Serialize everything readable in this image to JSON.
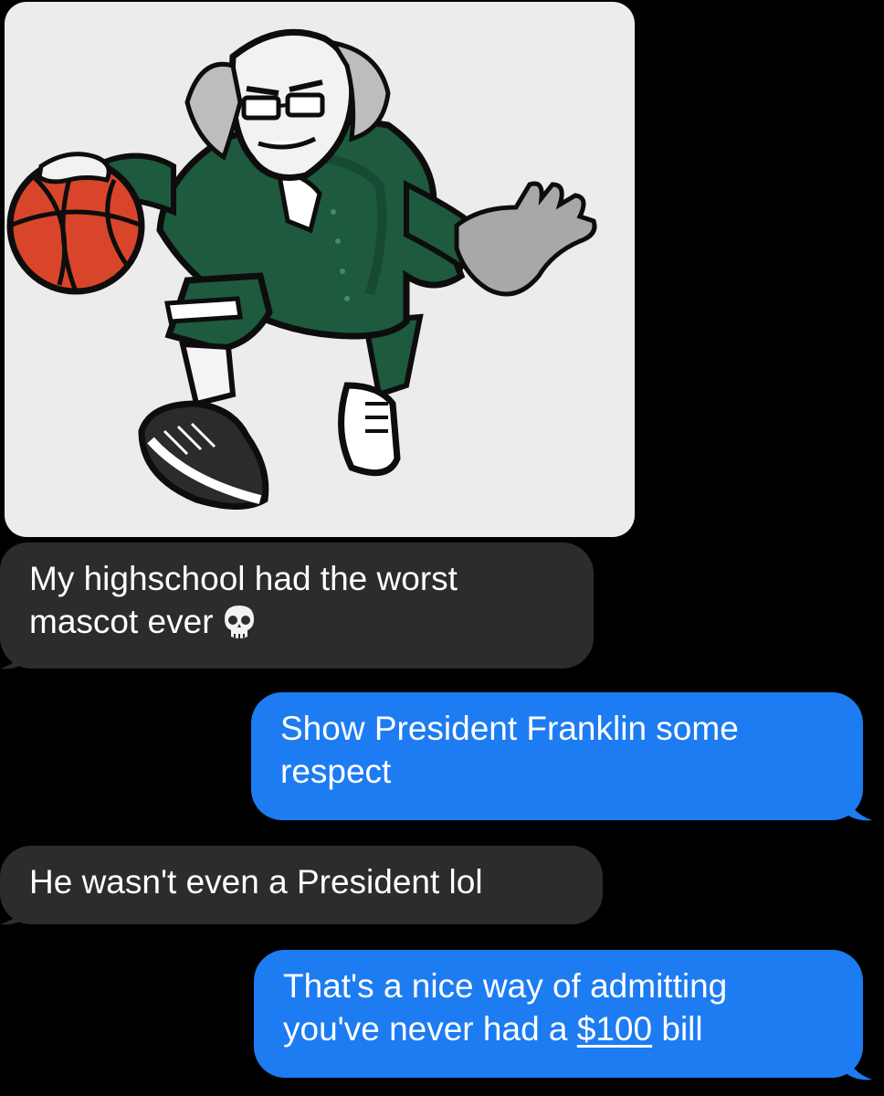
{
  "conversation": {
    "image_message": {
      "description_icon": "franklin-basketball-mascot-image",
      "direction": "received"
    },
    "messages": [
      {
        "direction": "received",
        "text_line1": "My highschool had the worst",
        "text_line2": "mascot ever",
        "emoji": "skull-icon"
      },
      {
        "direction": "sent",
        "text_line1": "Show President Franklin some",
        "text_line2": "respect"
      },
      {
        "direction": "received",
        "text_line1": "He wasn't even a President lol"
      },
      {
        "direction": "sent",
        "text_line1": "That's a nice way of admitting",
        "text_line2_prefix": "you've never had a ",
        "text_line2_link": "$100",
        "text_line2_suffix": " bill"
      }
    ]
  },
  "colors": {
    "background": "#000000",
    "received_bubble": "#2c2c2e",
    "sent_bubble": "#1d7cf2",
    "image_bubble": "#ececed",
    "mascot_green": "#1e5a3e",
    "ball_orange": "#d9452b"
  }
}
